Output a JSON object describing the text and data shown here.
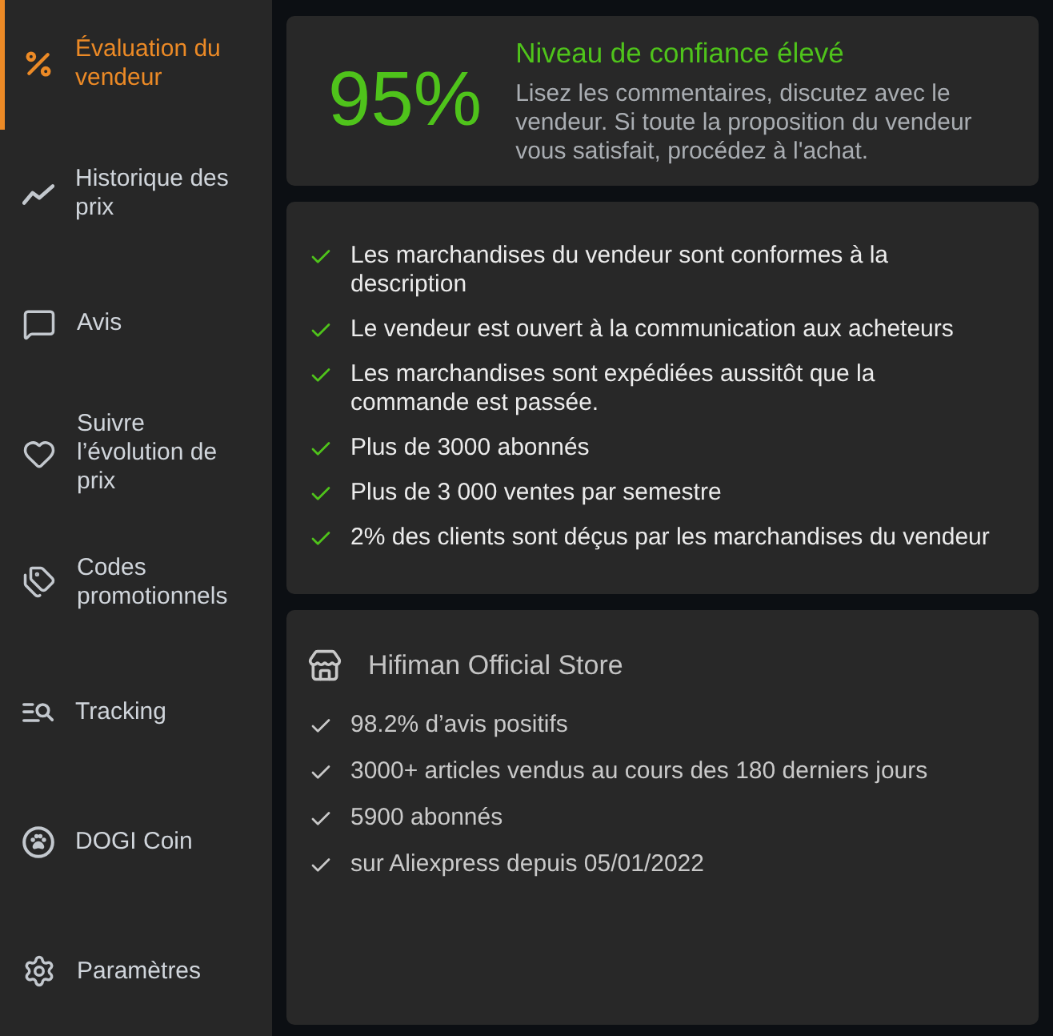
{
  "sidebar": {
    "items": [
      {
        "label": "Évaluation du vendeur",
        "selected": true
      },
      {
        "label": "Historique des prix",
        "selected": false
      },
      {
        "label": "Avis",
        "selected": false
      },
      {
        "label": "Suivre l’évolution de prix",
        "selected": false
      },
      {
        "label": "Codes promotionnels",
        "selected": false
      },
      {
        "label": "Tracking",
        "selected": false
      },
      {
        "label": "DOGI Coin",
        "selected": false
      },
      {
        "label": "Paramètres",
        "selected": false
      }
    ]
  },
  "trust": {
    "score": "95%",
    "title": "Niveau de confiance élevé",
    "description": "Lisez les commentaires, discutez avec le vendeur. Si toute la proposition du vendeur vous satisfait, procédez à l'achat."
  },
  "criteria": [
    "Les marchandises du vendeur sont conformes à la description",
    "Le vendeur est ouvert à la communication aux acheteurs",
    "Les marchandises sont expédiées aussitôt que la commande est passée.",
    "Plus de 3000 abonnés",
    "Plus de 3 000 ventes par semestre",
    "2% des clients sont déçus par les marchandises du vendeur"
  ],
  "store": {
    "name": "Hifiman Official Store",
    "facts": [
      "98.2% d’avis positifs",
      "3000+ articles vendus au cours des 180 derniers jours",
      "5900 abonnés",
      "sur Aliexpress depuis 05/01/2022"
    ]
  }
}
